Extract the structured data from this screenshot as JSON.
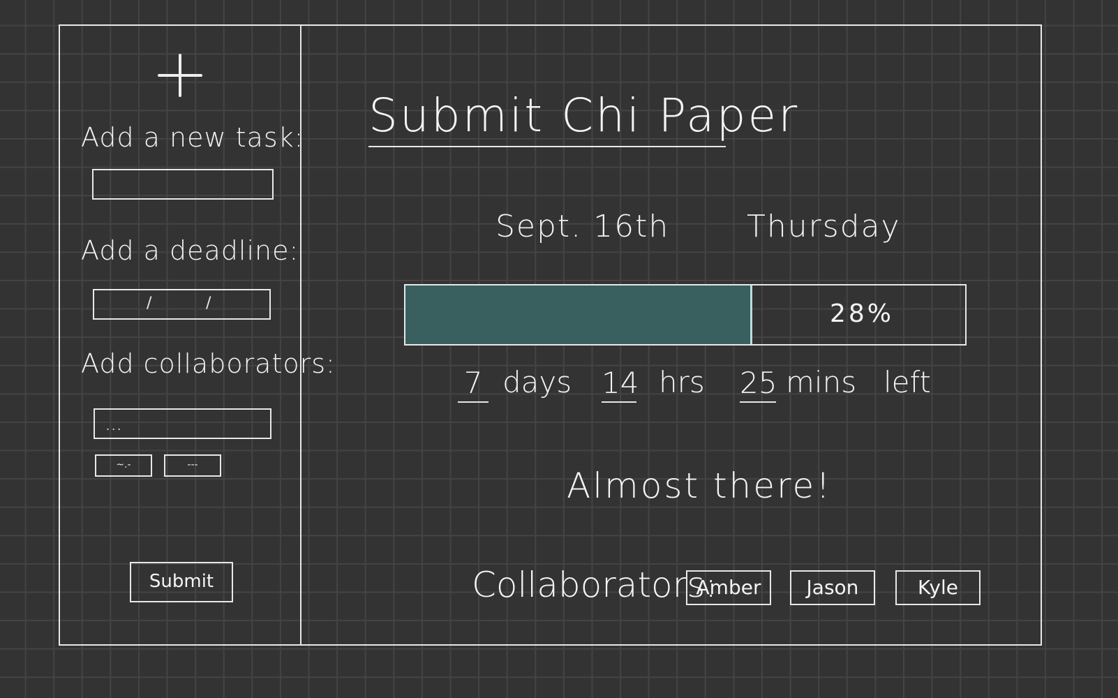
{
  "sidebar": {
    "new_task_label": "Add a new task:",
    "new_task_value": "",
    "deadline_label": "Add a deadline:",
    "deadline_separator": "/",
    "collaborators_label": "Add collaborators:",
    "collaborators_value": "...",
    "chip_1": "~.-",
    "chip_2": "---",
    "submit_label": "Submit"
  },
  "main": {
    "title": "Submit Chi Paper",
    "date": "Sept. 16th",
    "weekday": "Thursday",
    "progress": {
      "percent": 28,
      "percent_label": "28%",
      "bar_fill_fraction": 0.62,
      "fill_color": "#3a5f5f"
    },
    "countdown": {
      "days": "7",
      "days_unit": "days",
      "hours": "14",
      "hours_unit": "hrs",
      "minutes": "25",
      "minutes_unit": "mins",
      "suffix": "left"
    },
    "status_message": "Almost there!",
    "collaborators_label": "Collaborators:",
    "collaborators": [
      "Amber",
      "Jason",
      "Kyle"
    ]
  }
}
